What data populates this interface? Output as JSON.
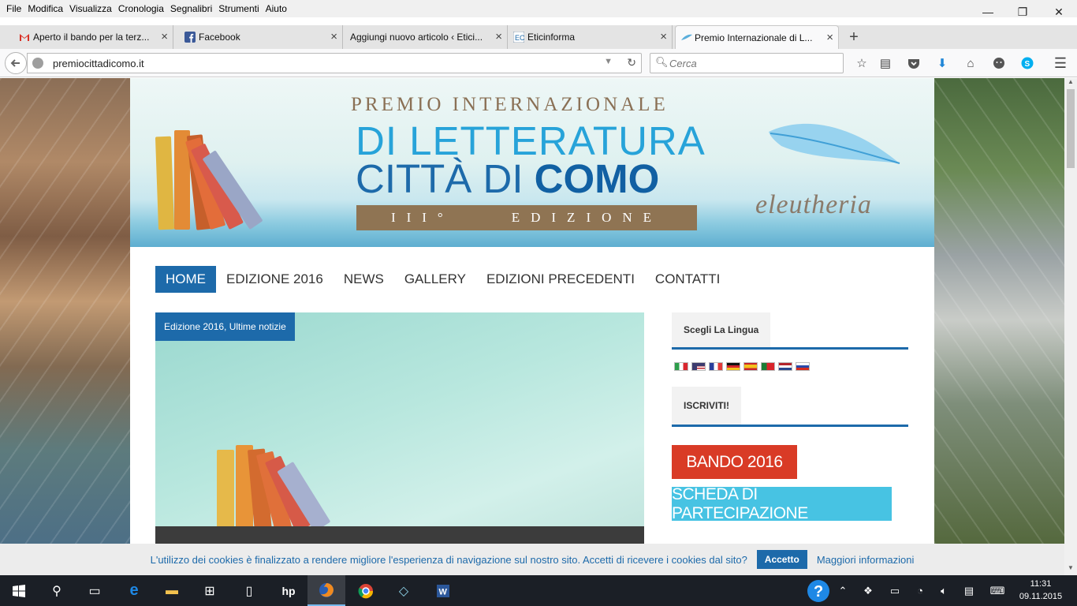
{
  "menubar": [
    "File",
    "Modifica",
    "Visualizza",
    "Cronologia",
    "Segnalibri",
    "Strumenti",
    "Aiuto"
  ],
  "window_controls": {
    "minimize": "—",
    "maximize": "❐",
    "close": "✕"
  },
  "tabs": [
    {
      "label": "Aperto il bando per la terz...",
      "icon": "gmail-icon",
      "color": "#d93025"
    },
    {
      "label": "Facebook",
      "icon": "facebook-icon",
      "color": "#3b5998"
    },
    {
      "label": "Aggiungi nuovo articolo ‹ Etici...",
      "icon": "",
      "color": ""
    },
    {
      "label": "Eticinforma",
      "icon": "eticinforma-icon",
      "color": "#1d6aaa"
    },
    {
      "label": "Premio Internazionale di L...",
      "icon": "feather-icon",
      "color": "#5aaedb",
      "active": true
    }
  ],
  "address": {
    "url": "premiocittadicomo.it"
  },
  "search": {
    "placeholder": "Cerca"
  },
  "banner": {
    "line1": "PREMIO INTERNAZIONALE",
    "line2": "DI LETTERATURA",
    "line3a": "CITTÀ DI ",
    "line3b": "COMO",
    "edition": "III°    EDIZIONE",
    "brand": "eleutheria"
  },
  "nav": [
    "HOME",
    "EDIZIONE 2016",
    "NEWS",
    "GALLERY",
    "EDIZIONI PRECEDENTI",
    "CONTATTI"
  ],
  "hero": {
    "category": "Edizione 2016, Ultime notizie"
  },
  "sidebar": {
    "language_title": "Scegli La Lingua",
    "subscribe_title": "ISCRIVITI!",
    "bando_button": "BANDO 2016",
    "scheda_button": "SCHEDA DI PARTECIPAZIONE"
  },
  "flags": [
    "italian",
    "english",
    "french",
    "german",
    "spanish",
    "portuguese",
    "dutch",
    "russian"
  ],
  "cookie": {
    "text": "L'utilizzo dei cookies è finalizzato a rendere migliore l'esperienza di navigazione sul nostro sito. Accetti di ricevere i cookies dal sito?",
    "accept": "Accetto",
    "more": "Maggiori informazioni"
  },
  "clock": {
    "time": "11:31",
    "date": "09.11.2015"
  }
}
